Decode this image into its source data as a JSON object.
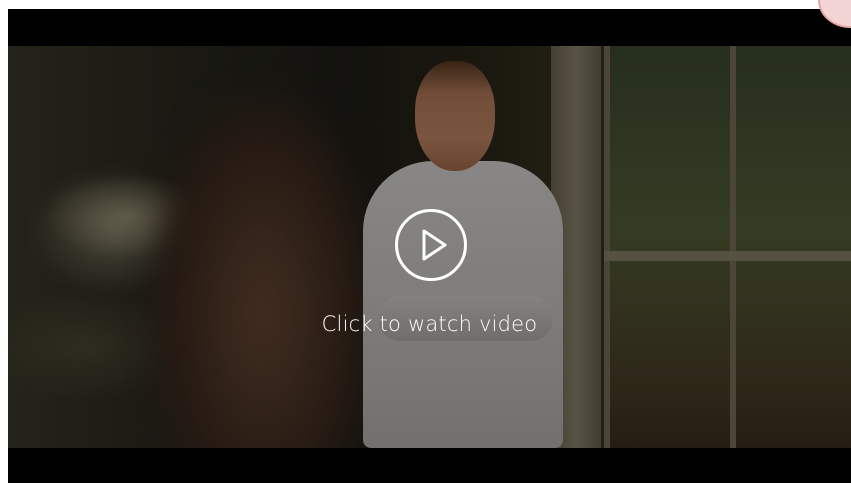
{
  "video": {
    "cta_label": "Click to watch video",
    "play_icon": "play-icon",
    "overlay_color": "#000000"
  },
  "colors": {
    "letterbox": "#000000",
    "play_ring": "#ffffff",
    "corner_badge": "#f3d4d4"
  }
}
